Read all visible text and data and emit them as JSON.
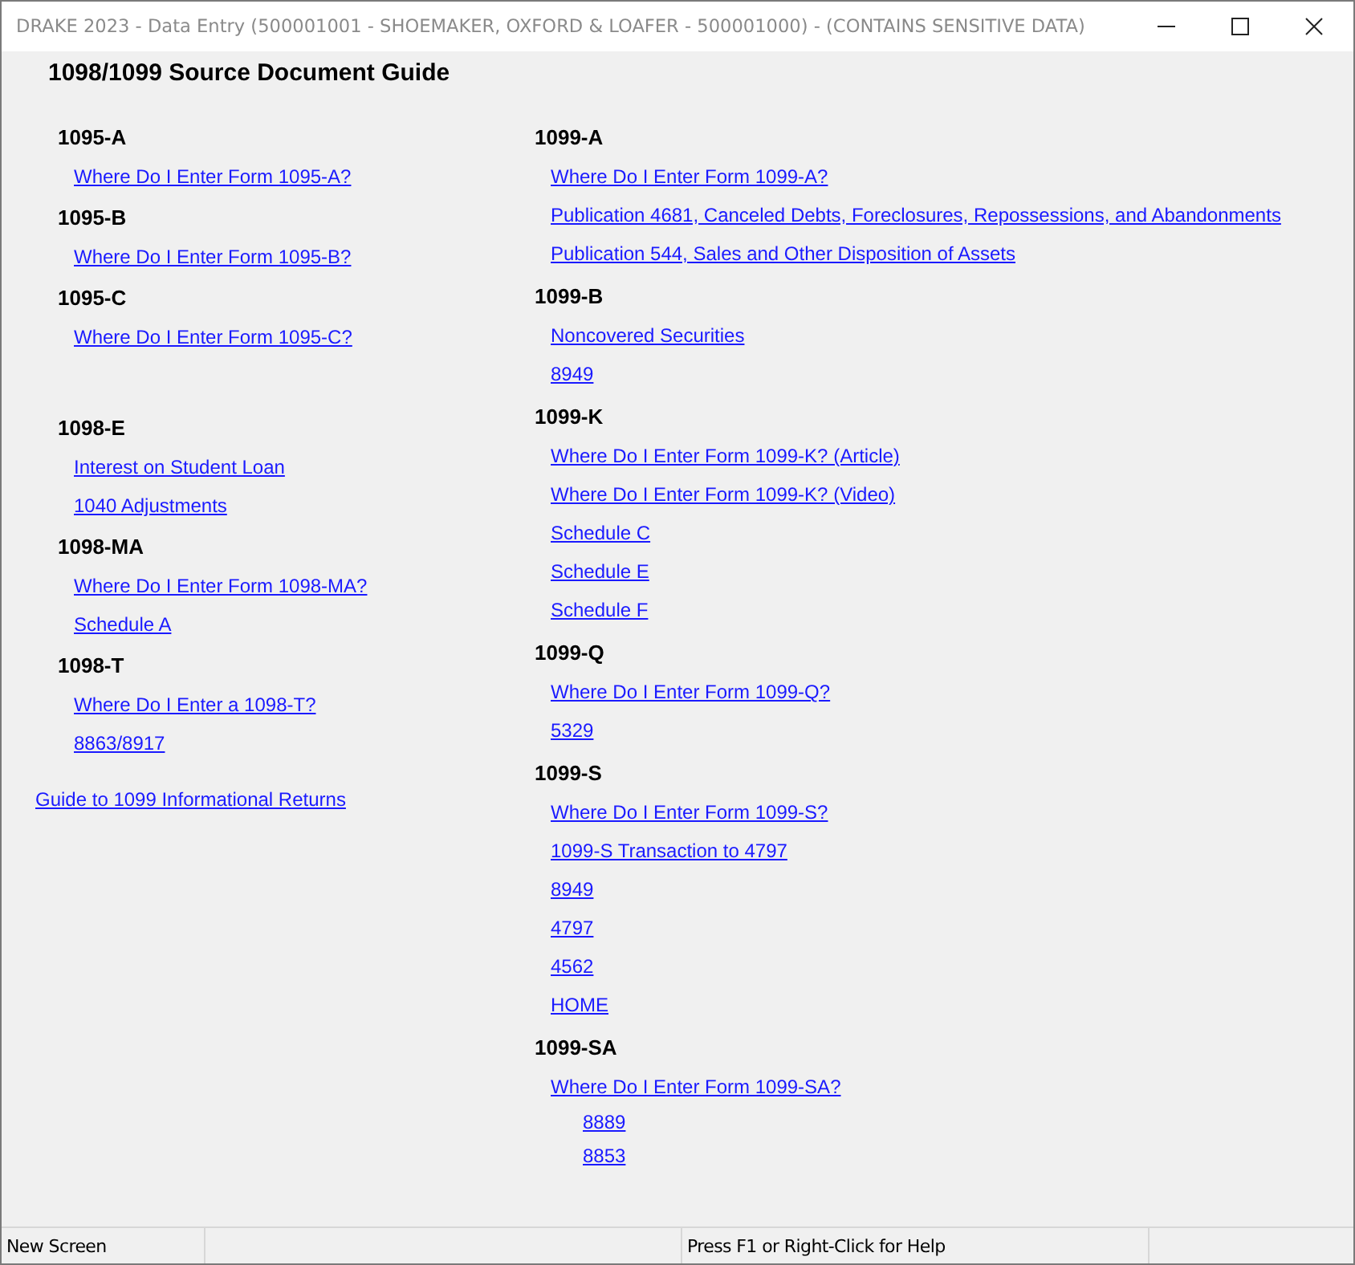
{
  "window": {
    "title": "DRAKE 2023 - Data Entry (500001001 - SHOEMAKER, OXFORD & LOAFER - 500001000) - (CONTAINS SENSITIVE DATA)"
  },
  "page_title": "1098/1099 Source Document Guide",
  "left_column": {
    "sections": [
      {
        "heading": "1095-A",
        "links": [
          {
            "text": "Where Do I Enter Form 1095-A?",
            "kind": "link"
          }
        ]
      },
      {
        "heading": "1095-B",
        "links": [
          {
            "text": "Where Do I Enter Form 1095-B?",
            "kind": "link"
          }
        ]
      },
      {
        "heading": "1095-C",
        "links": [
          {
            "text": "Where Do I Enter Form 1095-C?",
            "kind": "link"
          }
        ]
      },
      {
        "heading": "1098-E",
        "links": [
          {
            "text": "Interest on Student Loan",
            "kind": "link"
          },
          {
            "text": "1040 Adjustments",
            "kind": "link"
          }
        ]
      },
      {
        "heading": "1098-MA",
        "links": [
          {
            "text": "Where Do I Enter Form 1098-MA?",
            "kind": "link"
          },
          {
            "text": "Schedule A",
            "kind": "link"
          }
        ]
      },
      {
        "heading": "1098-T",
        "links": [
          {
            "text": "Where Do I Enter a 1098-T?",
            "kind": "link"
          },
          {
            "text": "8863/8917",
            "kind": "link"
          }
        ]
      }
    ],
    "footer_link": "Guide to 1099 Informational Returns"
  },
  "right_column": {
    "sections": [
      {
        "heading": "1099-A",
        "links": [
          {
            "text": "Where Do I Enter Form 1099-A?",
            "kind": "link"
          },
          {
            "text": "Publication 4681, Canceled Debts, Foreclosures, Repossessions, and Abandonments",
            "kind": "link"
          },
          {
            "text": "Publication 544, Sales and Other Disposition of Assets",
            "kind": "link"
          }
        ]
      },
      {
        "heading": "1099-B",
        "links": [
          {
            "text": "Noncovered Securities",
            "kind": "link"
          },
          {
            "text": "8949",
            "kind": "link"
          }
        ]
      },
      {
        "heading": "1099-K",
        "links": [
          {
            "text": "Where Do I Enter Form 1099-K? (Article)",
            "kind": "link"
          },
          {
            "text": "Where Do I Enter Form 1099-K? (Video)",
            "kind": "link"
          },
          {
            "text": "Schedule C",
            "kind": "link"
          },
          {
            "text": "Schedule E",
            "kind": "link"
          },
          {
            "text": "Schedule F",
            "kind": "link"
          }
        ]
      },
      {
        "heading": "1099-Q",
        "links": [
          {
            "text": "Where Do I Enter Form 1099-Q?",
            "kind": "link"
          },
          {
            "text": "5329",
            "kind": "link"
          }
        ]
      },
      {
        "heading": "1099-S",
        "links": [
          {
            "text": "Where Do I Enter Form 1099-S?",
            "kind": "link"
          },
          {
            "text": "1099-S Transaction to 4797",
            "kind": "link"
          },
          {
            "text": "8949",
            "kind": "link"
          },
          {
            "text": "4797",
            "kind": "link"
          },
          {
            "text": "4562",
            "kind": "link"
          },
          {
            "text": "HOME",
            "kind": "link"
          }
        ]
      },
      {
        "heading": "1099-SA",
        "links": [
          {
            "text": "Where Do I Enter Form 1099-SA?",
            "kind": "link"
          },
          {
            "text": "8889",
            "kind": "sublink"
          },
          {
            "text": "8853",
            "kind": "sublink"
          }
        ]
      }
    ]
  },
  "status_bar": {
    "left": "New Screen",
    "help": "Press F1 or Right-Click for Help"
  }
}
